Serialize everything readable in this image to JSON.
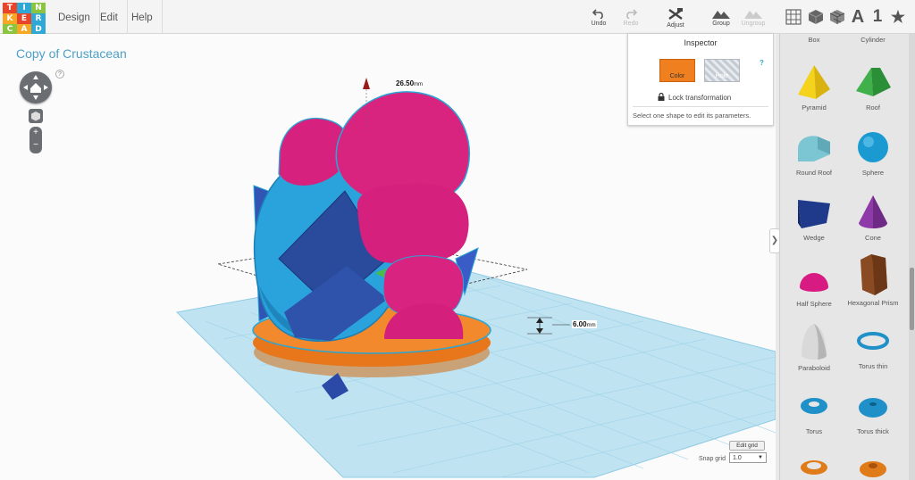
{
  "logo": {
    "letters": [
      "T",
      "I",
      "N",
      "K",
      "E",
      "R",
      "C",
      "A",
      "D"
    ],
    "colors": [
      "#e8442a",
      "#2fa8d5",
      "#8bc53f",
      "#f7a823",
      "#e8442a",
      "#2fa8d5",
      "#8bc53f",
      "#f7a823",
      "#2fa8d5"
    ]
  },
  "menu": {
    "items": [
      "Design",
      "Edit",
      "Help"
    ]
  },
  "toolbar": {
    "undo": "Undo",
    "redo": "Redo",
    "adjust": "Adjust",
    "group": "Group",
    "ungroup": "Ungroup",
    "view_text_label": "A",
    "view_number_label": "1"
  },
  "design_title": "Copy of Crustacean",
  "help_mark": "?",
  "dimensions": {
    "height_label": "26.50",
    "height_unit": "mm",
    "elevation_label": "6.00",
    "elevation_unit": "mm"
  },
  "inspector": {
    "title": "Inspector",
    "color_button": "Color",
    "hole_button": "Hole",
    "help": "?",
    "lock_label": "Lock transformation",
    "hint": "Select one shape to edit its parameters."
  },
  "grid": {
    "edit_button": "Edit grid",
    "snap_label": "Snap grid",
    "snap_value": "1.0"
  },
  "shapes": {
    "row0": [
      "Box",
      "Cylinder"
    ],
    "items": [
      {
        "label": "Pyramid",
        "color": "#f2d21b",
        "icon": "pyramid-icon"
      },
      {
        "label": "Roof",
        "color": "#3fb04a",
        "icon": "roof-icon"
      },
      {
        "label": "Round Roof",
        "color": "#7cc6d4",
        "icon": "round-roof-icon"
      },
      {
        "label": "Sphere",
        "color": "#1a9ad1",
        "icon": "sphere-icon"
      },
      {
        "label": "Wedge",
        "color": "#1f3a8a",
        "icon": "wedge-icon"
      },
      {
        "label": "Cone",
        "color": "#8e3aa8",
        "icon": "cone-icon"
      },
      {
        "label": "Half Sphere",
        "color": "#d81b82",
        "icon": "half-sphere-icon"
      },
      {
        "label": "Hexagonal Prism",
        "color": "#8a4a22",
        "icon": "hexagonal-prism-icon"
      },
      {
        "label": "Paraboloid",
        "color": "#d9d9d9",
        "icon": "paraboloid-icon"
      },
      {
        "label": "Torus thin",
        "color": "#1f90c8",
        "icon": "torus-thin-icon"
      },
      {
        "label": "Torus",
        "color": "#1f90c8",
        "icon": "torus-icon"
      },
      {
        "label": "Torus thick",
        "color": "#1f90c8",
        "icon": "torus-thick-icon"
      }
    ],
    "bottom_row_colors": [
      "#e07b1a",
      "#e07b1a"
    ]
  },
  "collapse_glyph": "❯",
  "colors": {
    "accent": "#4d9fc7",
    "grid": "#bfe3f1",
    "pink": "#d5207f",
    "blue": "#2b9fd4",
    "navy": "#243d8a",
    "orange": "#f07f1f"
  }
}
